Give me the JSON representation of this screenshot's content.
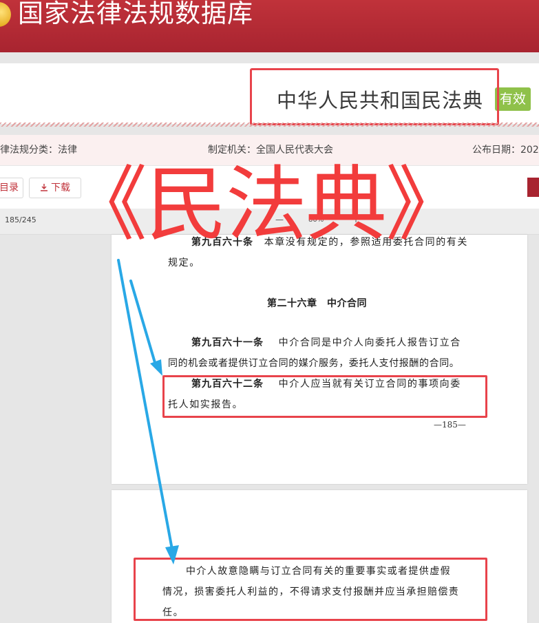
{
  "header": {
    "site_title": "国家法律法规数据库"
  },
  "law": {
    "title": "中华人民共和国民法典",
    "status": "有效"
  },
  "info": {
    "category": "律法规分类：法律",
    "authority": "制定机关：全国人民代表大会",
    "publish_date": "公布日期：202"
  },
  "toolbar": {
    "catalog_label": "目录",
    "download_label": "下载",
    "download_icon": "download-icon"
  },
  "viewer": {
    "page_counter": "185/245",
    "zoom_minus": "—",
    "zoom_level": "80%",
    "zoom_plus": "+"
  },
  "document": {
    "page1": {
      "line1_bold": "第九百六十条",
      "line1": "本章没有规定的，参照适用委托合同的有关",
      "line2": "规定。",
      "chapter": "第二十六章　中介合同",
      "art961_bold": "第九百六十一条",
      "art961_line1": "中介合同是中介人向委托人报告订立合",
      "art961_line2": "同的机会或者提供订立合同的媒介服务，委托人支付报酬的合同。",
      "art962_bold": "第九百六十二条",
      "art962_line1": "中介人应当就有关订立合同的事项向委",
      "art962_line2": "托人如实报告。",
      "page_number": "—185—"
    },
    "page2": {
      "line1": "中介人故意隐瞒与订立合同有关的重要事实或者提供虚假",
      "line2": "情况，损害委托人利益的，不得请求支付报酬并应当承担赔偿责",
      "line3": "任。"
    }
  },
  "overlay": {
    "watermark": "《民法典》",
    "highlight_color": "#e8434b",
    "arrow_color": "#29a8e6"
  },
  "colors": {
    "header_red": "#b52a35",
    "badge_green": "#8fc14a"
  }
}
